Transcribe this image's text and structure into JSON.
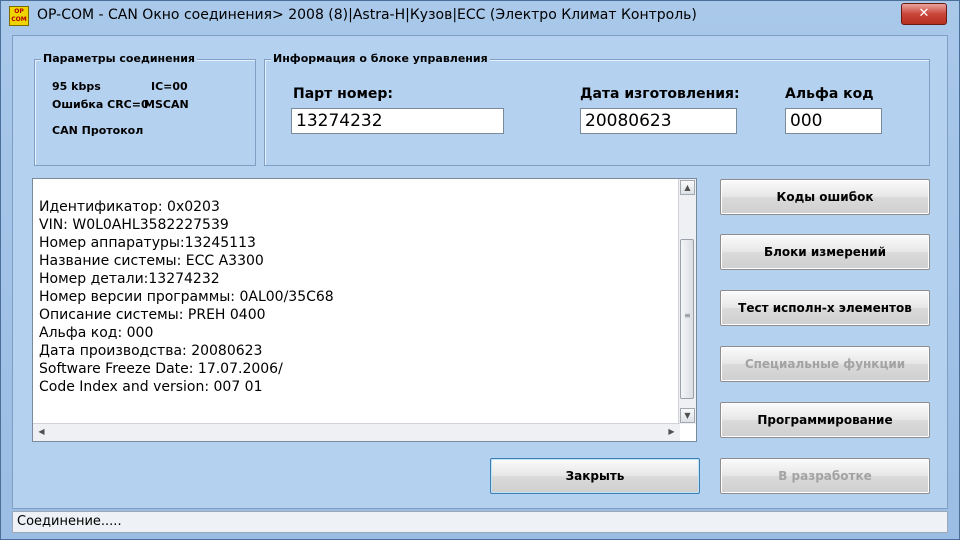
{
  "window": {
    "app_icon_text": "OP COM",
    "title": "OP-COM - CAN Окно соединения> 2008 (8)|Astra-H|Кузов|ECC (Электро Климат Контроль)",
    "close_glyph": "✕"
  },
  "connection_params": {
    "title": "Параметры соединения",
    "speed": "95 kbps",
    "ic": "IC=00",
    "crc_errors": "Ошибка CRC=0",
    "mscan": "MSCAN",
    "protocol": "CAN Протокол"
  },
  "ecu_info": {
    "title": "Информация о блоке управления",
    "part_label": "Парт номер:",
    "part_value": "13274232",
    "date_label": "Дата изготовления:",
    "date_value": "20080623",
    "alpha_label": "Альфа код",
    "alpha_value": "000"
  },
  "info_lines": [
    "Идентификатор: 0x0203",
    "VIN: W0L0AHL3582227539",
    "Номер аппаратуры:13245113",
    "Название системы: ECC A3300",
    "Номер детали:13274232",
    "Номер версии программы: 0AL00/35C68",
    "Описание системы: PREH 0400",
    "Альфа код: 000",
    "Дата производства: 20080623",
    "Software Freeze Date: 17.07.2006/",
    "Code Index and version: 007 01"
  ],
  "scroll_glyphs": {
    "up": "▲",
    "down": "▼",
    "left": "◀",
    "right": "▶"
  },
  "buttons": {
    "fault_codes": "Коды ошибок",
    "measurement_blocks": "Блоки измерений",
    "actuator_test": "Тест исполн-х элементов",
    "special_functions": "Специальные функции",
    "programming": "Программирование",
    "in_development": "В разработке",
    "close": "Закрыть"
  },
  "status": {
    "text": "Соединение....."
  }
}
